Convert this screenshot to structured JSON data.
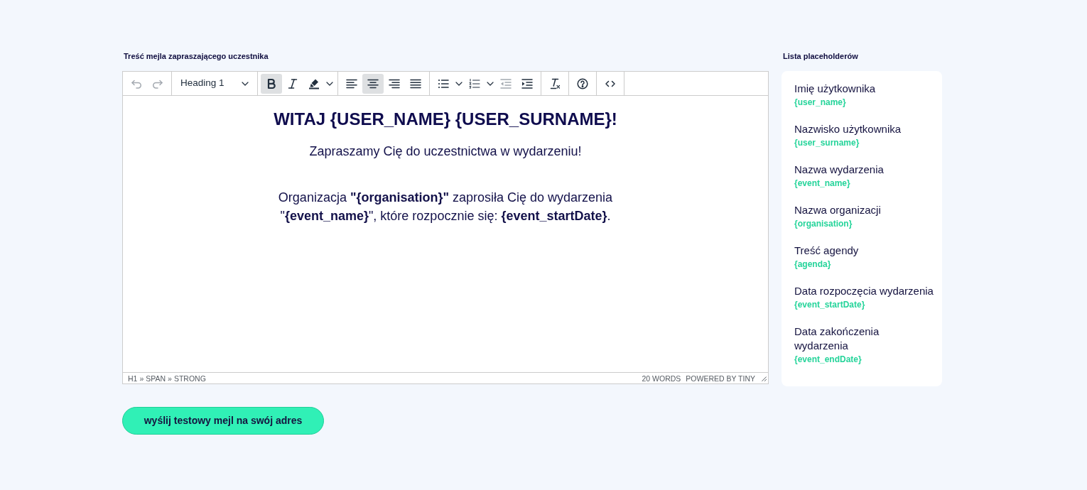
{
  "editor": {
    "label": "Treść mejla zapraszającego uczestnika",
    "toolbar": [
      {
        "items": [
          {
            "kind": "undo",
            "active": false,
            "disabled": true,
            "caret": false
          },
          {
            "kind": "redo",
            "active": false,
            "disabled": true,
            "caret": false
          }
        ]
      },
      {
        "items": [
          {
            "kind": "blocks",
            "value": "Heading 1"
          }
        ]
      },
      {
        "items": [
          {
            "kind": "bold",
            "active": true,
            "disabled": false,
            "caret": false
          },
          {
            "kind": "italic",
            "active": false,
            "disabled": false,
            "caret": false
          },
          {
            "kind": "highlight",
            "active": false,
            "disabled": false,
            "caret": true
          }
        ]
      },
      {
        "items": [
          {
            "kind": "alignleft",
            "active": false,
            "disabled": false,
            "caret": false
          },
          {
            "kind": "aligncenter",
            "active": true,
            "disabled": false,
            "caret": false
          },
          {
            "kind": "alignright",
            "active": false,
            "disabled": false,
            "caret": false
          },
          {
            "kind": "justify",
            "active": false,
            "disabled": false,
            "caret": false
          }
        ]
      },
      {
        "items": [
          {
            "kind": "bullist",
            "active": false,
            "disabled": false,
            "caret": true
          },
          {
            "kind": "numlist",
            "active": false,
            "disabled": false,
            "caret": true
          },
          {
            "kind": "outdent",
            "active": false,
            "disabled": true,
            "caret": false
          },
          {
            "kind": "indent",
            "active": false,
            "disabled": false,
            "caret": false
          }
        ]
      },
      {
        "items": [
          {
            "kind": "removeformat",
            "active": false,
            "disabled": false,
            "caret": false
          }
        ]
      },
      {
        "items": [
          {
            "kind": "help",
            "active": false,
            "disabled": false,
            "caret": false
          }
        ]
      },
      {
        "items": [
          {
            "kind": "code",
            "active": false,
            "disabled": false,
            "caret": false
          }
        ]
      }
    ],
    "content": [
      {
        "kind": "heading",
        "text": "WITAJ {USER_NAME} {USER_SURNAME}!"
      },
      {
        "kind": "paragraph",
        "text": "Zapraszamy Cię do uczestnictwa w wydarzeniu!"
      },
      {
        "kind": "paragraph",
        "text": "Organizacja **\"{organisation}\"** zaprosiła Cię do wydarzenia \"**{event_name}**\", które rozpocznie się: **{event_startDate}**."
      }
    ],
    "status_bar": {
      "path": [
        {
          "label": "H1",
          "separator": "»"
        },
        {
          "label": "SPAN",
          "separator": "»"
        },
        {
          "label": "STRONG"
        }
      ],
      "word_count": "20 WORDS",
      "branding": "POWERED BY TINY"
    }
  },
  "placeholders": {
    "title": "Lista placeholderów",
    "items": [
      {
        "label": "Imię użytkownika",
        "token": "{user_name}"
      },
      {
        "label": "Nazwisko użytkownika",
        "token": "{user_surname}"
      },
      {
        "label": "Nazwa wydarzenia",
        "token": "{event_name}"
      },
      {
        "label": "Nazwa organizacji",
        "token": "{organisation}"
      },
      {
        "label": "Treść agendy",
        "token": "{agenda}"
      },
      {
        "label": "Data rozpoczęcia wydarzenia",
        "token": "{event_startDate}"
      },
      {
        "label": "Data zakończenia wydarzenia",
        "token": "{event_endDate}"
      }
    ]
  },
  "send_button": {
    "label": "wyślij testowy mejl na swój adres"
  }
}
